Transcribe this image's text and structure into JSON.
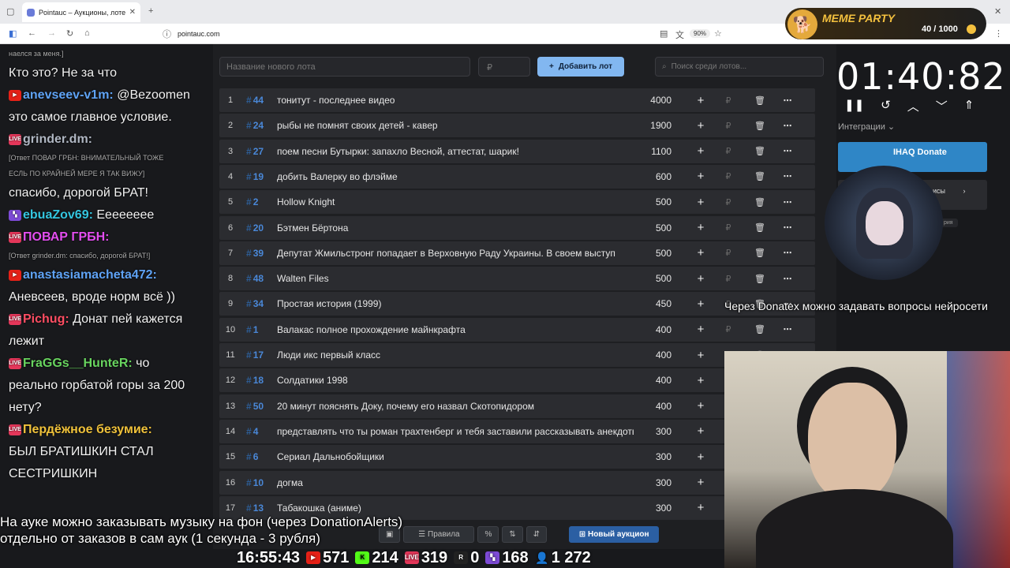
{
  "browser": {
    "tab_title": "Pointauc – Аукционы, лотереи",
    "url": "pointauc.com",
    "zoom": "90%"
  },
  "app": {
    "lot_placeholder": "Название нового лота",
    "price_placeholder": "₽",
    "add_button": "Добавить лот",
    "search_placeholder": "Поиск среди лотов...",
    "lots": [
      {
        "n": "1",
        "id": "44",
        "name": "тонитут - последнее видео",
        "amount": "4000"
      },
      {
        "n": "2",
        "id": "24",
        "name": "рыбы не помнят своих детей - кавер",
        "amount": "1900"
      },
      {
        "n": "3",
        "id": "27",
        "name": "поем песни Бутырки: запахло Весной, аттестат, шарик!",
        "amount": "1100"
      },
      {
        "n": "4",
        "id": "19",
        "name": "добить Валерку во флэйме",
        "amount": "600"
      },
      {
        "n": "5",
        "id": "2",
        "name": "Hollow Knight",
        "amount": "500"
      },
      {
        "n": "6",
        "id": "20",
        "name": "Бэтмен Бёртона",
        "amount": "500"
      },
      {
        "n": "7",
        "id": "39",
        "name": "Депутат Жмильстронг попадает в Верховную Раду Украины. В своем выступ",
        "amount": "500"
      },
      {
        "n": "8",
        "id": "48",
        "name": "Walten Files",
        "amount": "500"
      },
      {
        "n": "9",
        "id": "34",
        "name": "Простая история (1999)",
        "amount": "450"
      },
      {
        "n": "10",
        "id": "1",
        "name": "Валакас полное прохождение майнкрафта",
        "amount": "400"
      },
      {
        "n": "11",
        "id": "17",
        "name": "Люди икс первый класс",
        "amount": "400"
      },
      {
        "n": "12",
        "id": "18",
        "name": "Солдатики 1998",
        "amount": "400"
      },
      {
        "n": "13",
        "id": "50",
        "name": "20 минут пояснять Доку, почему его назвал Скотопидором",
        "amount": "400"
      },
      {
        "n": "14",
        "id": "4",
        "name": "представлять что ты роман трахтенберг и тебя заставили рассказывать анекдоты",
        "amount": "300"
      },
      {
        "n": "15",
        "id": "6",
        "name": "Сериал Дальнобойщики",
        "amount": "300"
      },
      {
        "n": "16",
        "id": "10",
        "name": "догма",
        "amount": "300"
      },
      {
        "n": "17",
        "id": "13",
        "name": "Табакошка (аниме)",
        "amount": "300"
      }
    ],
    "bottom": {
      "rules": "Правила",
      "percent": "%",
      "new_auction": "Новый аукцион"
    },
    "timer": "01:40:82",
    "integrations": "Интеграции",
    "donate_service": "IHAQ Donate",
    "services_label": "исы",
    "services_sub": "рия"
  },
  "overlay": {
    "meme_title": "MEME PARTY",
    "meme_count": "40 / 1000",
    "ai_caption": "Через Donatex можно задавать вопросы нейросети",
    "caption_line1": "На ауке можно заказывать музыку на фон (через DonationAlerts)",
    "caption_line2": "отдельно от заказов в сам аук (1 секунда - 3 рубля)",
    "stats": {
      "time": "16:55:43",
      "youtube": "571",
      "kick": "214",
      "live": "319",
      "r": "0",
      "twitch": "168",
      "viewers": "1 272"
    }
  },
  "chat": [
    {
      "type": "small",
      "text": "наелся за меня.]"
    },
    {
      "type": "msg",
      "text": "Кто это? Не за что"
    },
    {
      "type": "user",
      "badge": "yt",
      "user": "anevseev-v1m:",
      "color": "u-blue",
      "text": " @Bezoomen"
    },
    {
      "type": "msg",
      "text": "это самое главное условие."
    },
    {
      "type": "user",
      "badge": "live",
      "user": "grinder.dm:",
      "color": "u-grey",
      "text": ""
    },
    {
      "type": "small",
      "text": "[Ответ ПОВАР ГРБН: ВНИМАТЕЛЬНЫЙ ТОЖЕ"
    },
    {
      "type": "small",
      "text": "ЕСЛЬ ПО КРАЙНЕЙ МЕРЕ Я ТАК ВИЖУ]"
    },
    {
      "type": "msg",
      "text": "спасибо, дорогой БРАТ!"
    },
    {
      "type": "user",
      "badge": "twitch",
      "user": "ebuaZov69:",
      "color": "u-cyan",
      "text": " Ееееееее"
    },
    {
      "type": "user",
      "badge": "live",
      "user": "ПОВАР ГРБН:",
      "color": "u-pink",
      "text": ""
    },
    {
      "type": "small",
      "text": "[Ответ grinder.dm: спасибо, дорогой БРАТ!]"
    },
    {
      "type": "user",
      "badge": "yt",
      "user": "anastasiamacheta472:",
      "color": "u-blue",
      "text": ""
    },
    {
      "type": "msg",
      "text": "Аневсеев, вроде норм всё ))"
    },
    {
      "type": "user",
      "badge": "live",
      "user": "Pichug:",
      "color": "u-red",
      "text": " Донат пей кажется"
    },
    {
      "type": "msg",
      "text": "лежит"
    },
    {
      "type": "user",
      "badge": "live",
      "user": "FraGGs__HunteR:",
      "color": "u-green",
      "text": " чо"
    },
    {
      "type": "msg",
      "text": "реально горбатой горы за 200"
    },
    {
      "type": "msg",
      "text": "нету?"
    },
    {
      "type": "user",
      "badge": "live",
      "user": "Пердёжное безумие:",
      "color": "u-yellow",
      "text": ""
    },
    {
      "type": "msg",
      "text": "БЫЛ БРАТИШКИН СТАЛ"
    },
    {
      "type": "msg",
      "text": "СЕСТРИШКИН"
    }
  ]
}
